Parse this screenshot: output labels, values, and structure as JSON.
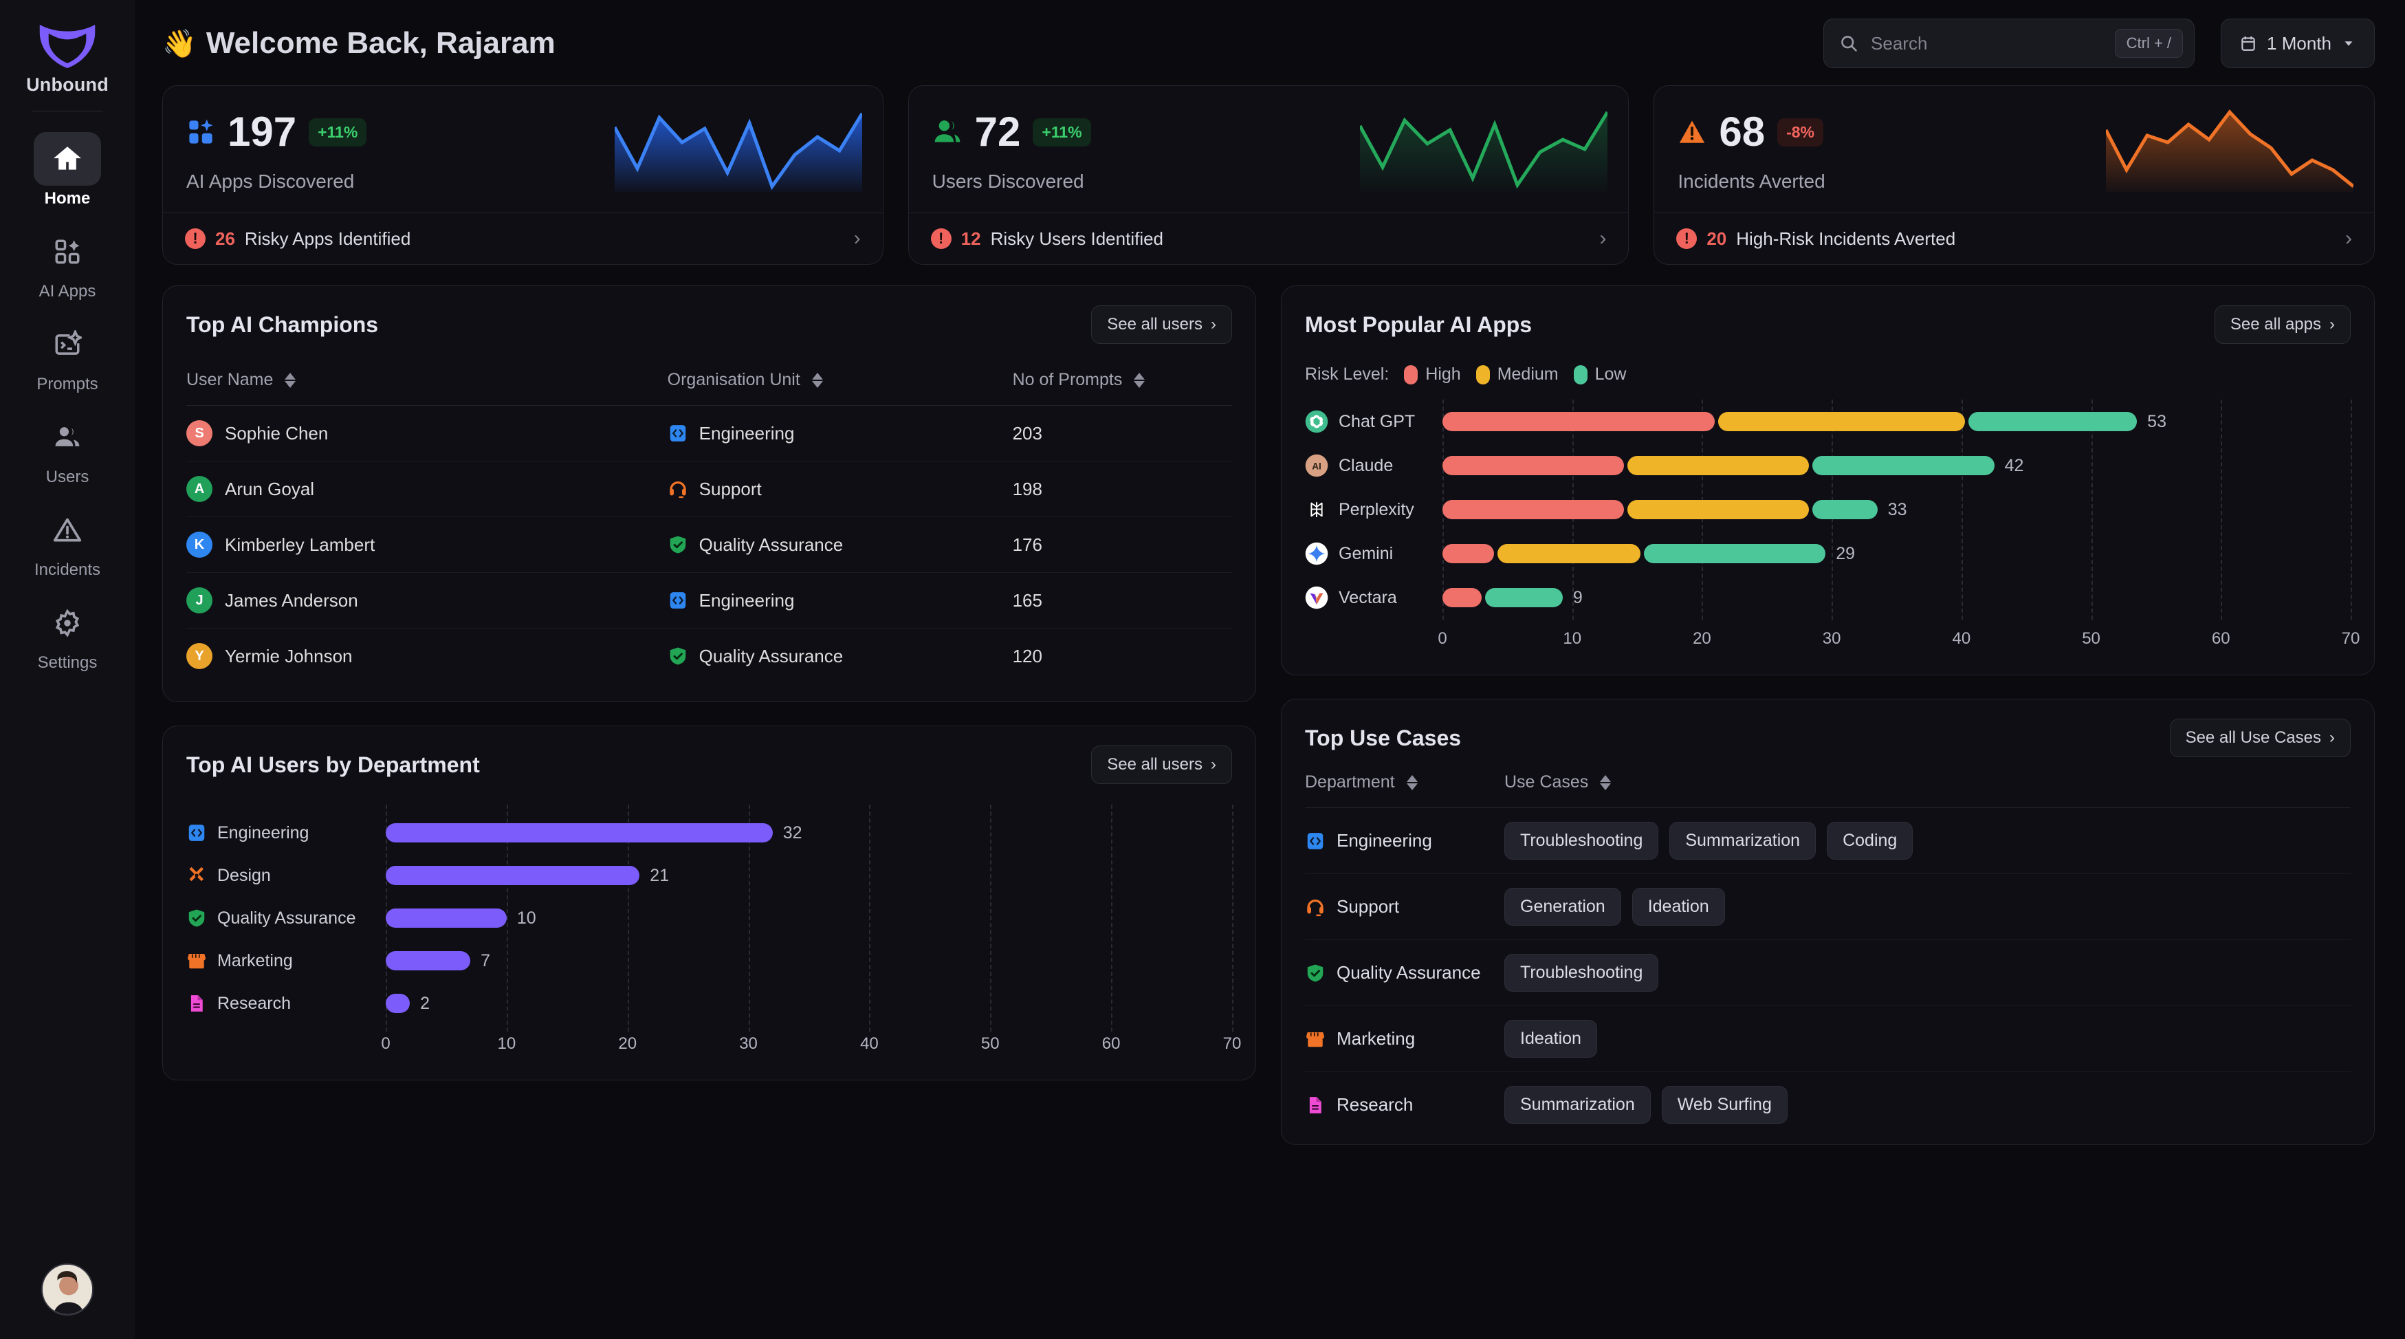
{
  "brand": {
    "name": "Unbound",
    "logo_icon": "shield-logo-icon",
    "accent": "#7c5cfa"
  },
  "sidebar": {
    "items": [
      {
        "label": "Home",
        "icon": "home-icon",
        "active": true
      },
      {
        "label": "AI Apps",
        "icon": "apps-sparkle-icon",
        "active": false
      },
      {
        "label": "Prompts",
        "icon": "terminal-sparkle-icon",
        "active": false
      },
      {
        "label": "Users",
        "icon": "users-icon",
        "active": false
      },
      {
        "label": "Incidents",
        "icon": "warning-triangle-icon",
        "active": false
      },
      {
        "label": "Settings",
        "icon": "gear-icon",
        "active": false
      }
    ],
    "profile_avatar": "user-photo-avatar"
  },
  "header": {
    "greeting": "Welcome Back, Rajaram",
    "wave_icon": "waving-hand-icon",
    "search": {
      "placeholder": "Search",
      "value": "",
      "shortcut": "Ctrl + /",
      "icon": "search-icon"
    },
    "date_range": {
      "label": "1 Month",
      "icon": "calendar-icon",
      "chevron": "chevron-down-icon"
    }
  },
  "kpi_cards": [
    {
      "value": "197",
      "label": "AI Apps Discovered",
      "delta": "+11%",
      "delta_dir": "up",
      "icon": "apps-sparkle-icon",
      "accent": "#3b82f6",
      "footer_count": "26",
      "footer_text": "Risky Apps Identified",
      "spark": [
        58,
        22,
        70,
        48,
        62,
        20,
        66,
        6,
        36,
        56,
        40,
        75
      ]
    },
    {
      "value": "72",
      "label": "Users Discovered",
      "delta": "+11%",
      "delta_dir": "up",
      "icon": "users-icon",
      "accent": "#22a555",
      "footer_count": "12",
      "footer_text": "Risky Users Identified",
      "spark": [
        60,
        24,
        72,
        46,
        64,
        18,
        64,
        8,
        38,
        58,
        42,
        78
      ]
    },
    {
      "value": "68",
      "label": "Incidents Averted",
      "delta": "-8%",
      "delta_dir": "down",
      "icon": "warning-triangle-icon",
      "accent": "#f07327",
      "footer_count": "20",
      "footer_text": "High-Risk Incidents Averted",
      "spark": [
        56,
        22,
        62,
        55,
        70,
        50,
        88,
        60,
        46,
        20,
        34,
        6
      ]
    }
  ],
  "champions": {
    "title": "Top AI Champions",
    "see_all": "See all users",
    "columns": [
      "User Name",
      "Organisation Unit",
      "No of Prompts"
    ],
    "rows": [
      {
        "name": "Sophie Chen",
        "initial": "S",
        "avatar_color": "#ee7b72",
        "dept": "Engineering",
        "dept_icon": "code-icon",
        "prompts": "203"
      },
      {
        "name": "Arun Goyal",
        "initial": "A",
        "avatar_color": "#21a05a",
        "dept": "Support",
        "dept_icon": "headset-icon",
        "prompts": "198"
      },
      {
        "name": "Kimberley Lambert",
        "initial": "K",
        "avatar_color": "#2e86f0",
        "dept": "Quality Assurance",
        "dept_icon": "shield-check-icon",
        "prompts": "176"
      },
      {
        "name": "James Anderson",
        "initial": "J",
        "avatar_color": "#21a05a",
        "dept": "Engineering",
        "dept_icon": "code-icon",
        "prompts": "165"
      },
      {
        "name": "Yermie Johnson",
        "initial": "Y",
        "avatar_color": "#e9a22a",
        "dept": "Quality Assurance",
        "dept_icon": "shield-check-icon",
        "prompts": "120"
      }
    ]
  },
  "popular_apps": {
    "title": "Most Popular AI Apps",
    "see_all": "See all apps",
    "legend_label": "Risk Level:"
  },
  "dept_users": {
    "title": "Top AI Users by Department",
    "see_all": "See all users"
  },
  "use_cases": {
    "title": "Top Use Cases",
    "see_all": "See all Use Cases",
    "columns": [
      "Department",
      "Use Cases"
    ],
    "rows": [
      {
        "dept": "Engineering",
        "dept_icon": "code-icon",
        "tags": [
          "Troubleshooting",
          "Summarization",
          "Coding"
        ]
      },
      {
        "dept": "Support",
        "dept_icon": "headset-icon",
        "tags": [
          "Generation",
          "Ideation"
        ]
      },
      {
        "dept": "Quality Assurance",
        "dept_icon": "shield-check-icon",
        "tags": [
          "Troubleshooting"
        ]
      },
      {
        "dept": "Marketing",
        "dept_icon": "storefront-icon",
        "tags": [
          "Ideation"
        ]
      },
      {
        "dept": "Research",
        "dept_icon": "document-icon",
        "tags": [
          "Summarization",
          "Web Surfing"
        ]
      }
    ]
  },
  "chart_data": [
    {
      "type": "bar",
      "id": "most-popular-ai-apps",
      "title": "Most Popular AI Apps",
      "orientation": "horizontal",
      "stacked": true,
      "xlabel": "",
      "ylabel": "",
      "xlim": [
        0,
        70
      ],
      "ticks": [
        0,
        10,
        20,
        30,
        40,
        50,
        60,
        70
      ],
      "grid": true,
      "legend": {
        "position": "top-left",
        "title": "Risk Level:"
      },
      "series": [
        {
          "name": "High",
          "color": "#f0706a",
          "values": [
            21,
            14,
            14,
            4,
            3
          ]
        },
        {
          "name": "Medium",
          "color": "#f0b429",
          "values": [
            19,
            14,
            14,
            11,
            0
          ]
        },
        {
          "name": "Low",
          "color": "#4cc79a",
          "values": [
            13,
            14,
            5,
            14,
            6
          ]
        }
      ],
      "categories": [
        "Chat GPT",
        "Claude",
        "Perplexity",
        "Gemini",
        "Vectara"
      ],
      "category_icons": [
        "chatgpt-icon",
        "claude-icon",
        "perplexity-icon",
        "gemini-icon",
        "vectara-icon"
      ],
      "totals": [
        53,
        42,
        33,
        29,
        9
      ],
      "data_labels": [
        "53",
        "42",
        "33",
        "29",
        "9"
      ]
    },
    {
      "type": "bar",
      "id": "top-ai-users-by-department",
      "title": "Top AI Users by Department",
      "orientation": "horizontal",
      "stacked": false,
      "xlabel": "",
      "ylabel": "",
      "xlim": [
        0,
        70
      ],
      "ticks": [
        0,
        10,
        20,
        30,
        40,
        50,
        60,
        70
      ],
      "grid": true,
      "bar_color": "#7c5cfa",
      "categories": [
        "Engineering",
        "Design",
        "Quality Assurance",
        "Marketing",
        "Research"
      ],
      "category_icons": [
        "code-icon",
        "design-tools-icon",
        "shield-check-icon",
        "storefront-icon",
        "document-icon"
      ],
      "values": [
        32,
        21,
        10,
        7,
        2
      ],
      "data_labels": [
        "32",
        "21",
        "10",
        "7",
        "2"
      ]
    }
  ]
}
